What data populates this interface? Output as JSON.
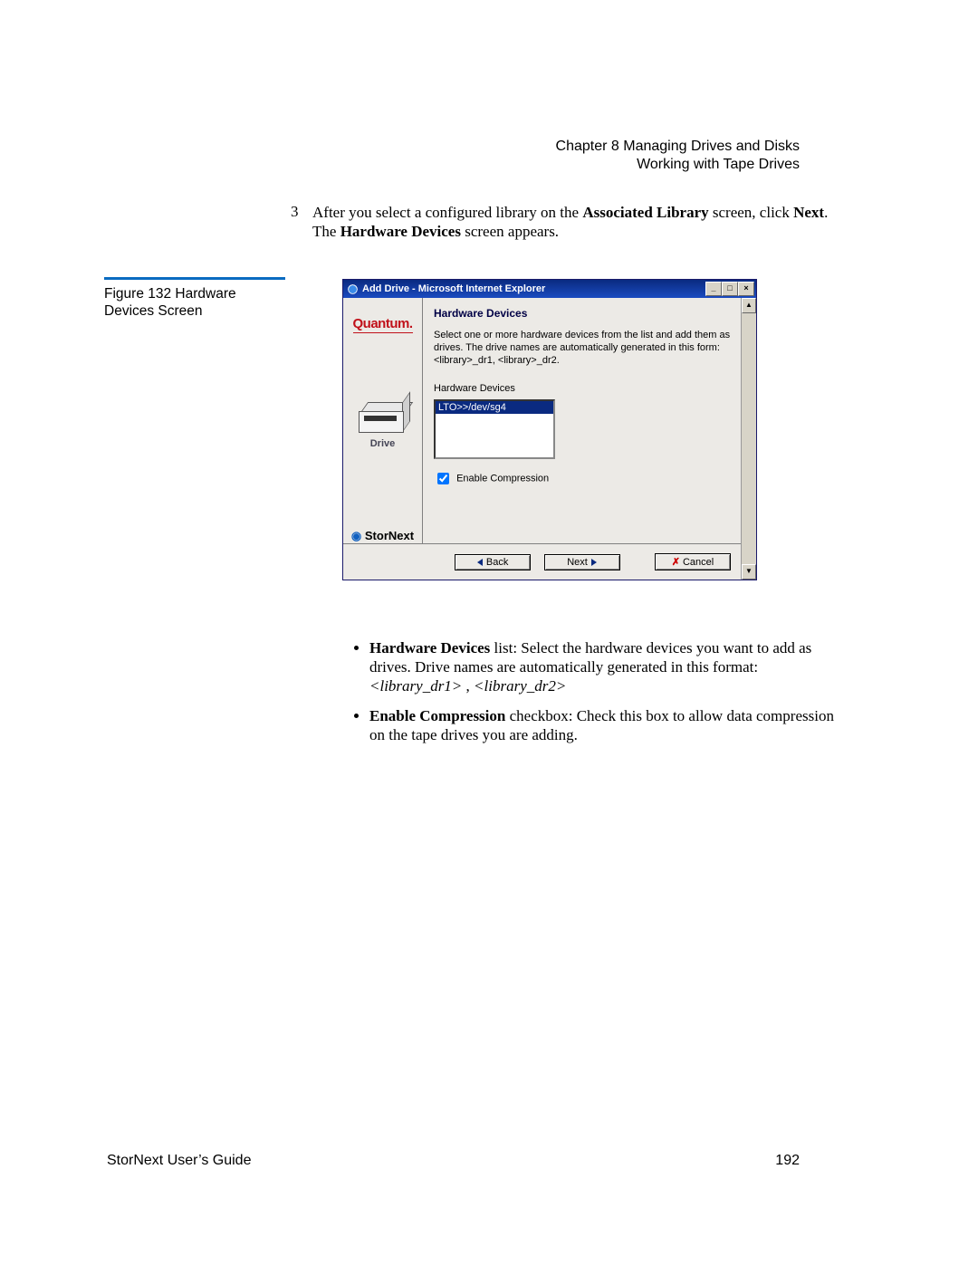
{
  "header": {
    "line1": "Chapter 8  Managing Drives and Disks",
    "line2": "Working with Tape Drives"
  },
  "step": {
    "number": "3",
    "pre": "After you select a configured library on the ",
    "bold1": "Associated Library",
    "mid": " screen, click ",
    "bold2": "Next",
    "post1": ". The ",
    "bold3": "Hardware Devices",
    "post2": " screen appears."
  },
  "figure": {
    "label": "Figure 132  Hardware Devices Screen"
  },
  "window": {
    "title": "Add Drive - Microsoft Internet Explorer",
    "btn_min": "_",
    "btn_max": "□",
    "btn_close": "×",
    "left": {
      "brand": "Quantum.",
      "drive_label": "Drive",
      "product": "StorNext",
      "globe": "◉"
    },
    "content": {
      "title": "Hardware Devices",
      "desc": "Select one or more hardware devices from the list and add them as drives. The drive names are automatically generated in this form: <library>_dr1, <library>_dr2.",
      "list_label": "Hardware Devices",
      "list_item": "LTO>>/dev/sg4",
      "enable_compression_checked": true,
      "enable_compression_label": "Enable Compression"
    },
    "buttons": {
      "back": "Back",
      "next": "Next",
      "cancel": "Cancel",
      "cancel_x": "✗"
    },
    "scroll_up": "▲",
    "scroll_down": "▼"
  },
  "bullets": {
    "b1_strong": "Hardware Devices",
    "b1_text": " list: Select the hardware devices you want to add as drives. Drive names are automatically generated in this format: ",
    "b1_i1": "<library_dr1>",
    "b1_sep": " ,   ",
    "b1_i2": "<library_dr2>",
    "b2_strong": "Enable Compression",
    "b2_text": " checkbox: Check this box to allow data compression on the tape drives you are adding."
  },
  "footer": {
    "left": "StorNext User’s Guide",
    "right": "192"
  }
}
